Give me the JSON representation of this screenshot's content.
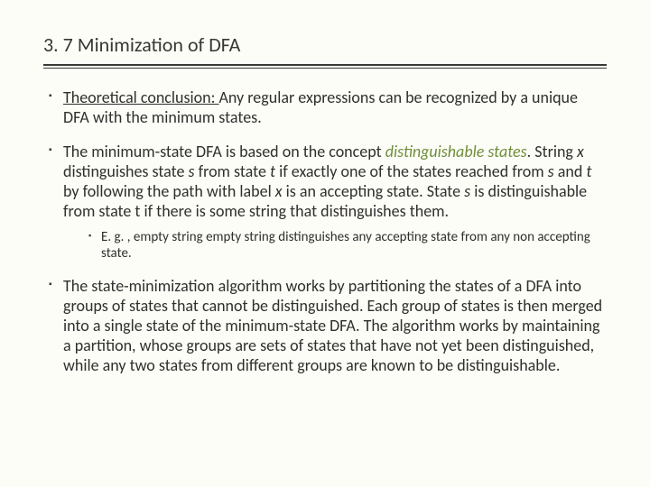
{
  "slide": {
    "title": "3. 7 Minimization of DFA",
    "b1": {
      "lead": "Theoretical conclusion: ",
      "rest": "Any regular expressions can be recognized by a unique DFA with the minimum states."
    },
    "b2": {
      "p1": "The minimum-state DFA is based on the concept ",
      "term": "distinguishable states",
      "p2": ".  String ",
      "x1": "x",
      "p3": " distinguishes state ",
      "s1": "s",
      "p4": " from state ",
      "t1": "t",
      "p5": " if exactly one of the states reached from ",
      "s2": "s",
      "p6": " and ",
      "t2": "t",
      "p7": " by following the path with label ",
      "x2": "x",
      "p8": " is an accepting state. State ",
      "s3": "s",
      "p9": " is distinguishable from state t if there is some string that distinguishes them."
    },
    "b2sub": "E. g. , empty string empty string distinguishes any accepting state from any non accepting state.",
    "b3": "The state-minimization algorithm works by partitioning the states of a DFA into groups of states that cannot be distinguished. Each group of states is then merged into a single state of the minimum-state DFA. The algorithm works by maintaining a partition, whose groups are sets of states that have not yet been distinguished, while any two states from different groups are known to be distinguishable."
  }
}
